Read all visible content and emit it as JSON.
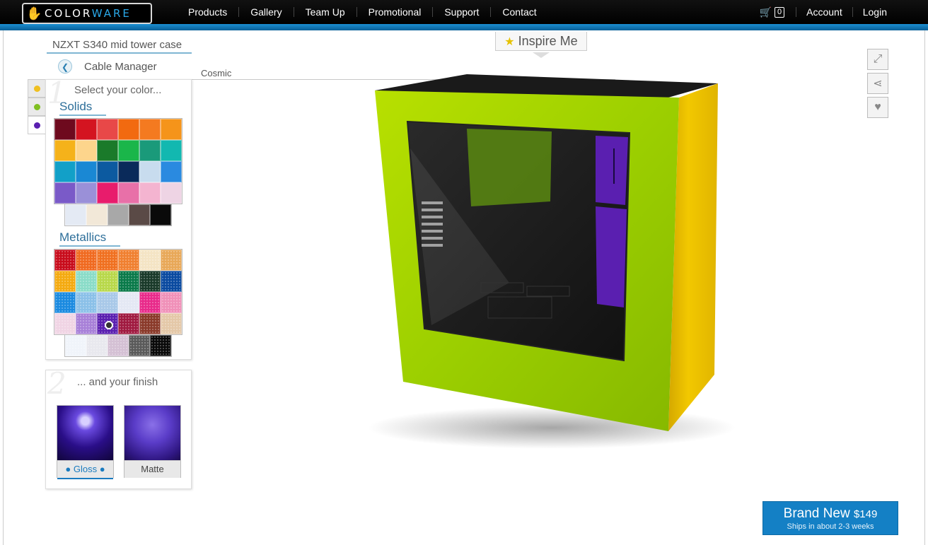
{
  "header": {
    "logo_text_a": "COLOR",
    "logo_text_b": "WARE",
    "nav": [
      "Products",
      "Gallery",
      "Team Up",
      "Promotional",
      "Support",
      "Contact"
    ],
    "cart_count": "0",
    "account": "Account",
    "login": "Login"
  },
  "product": {
    "title": "NZXT S340 mid tower case",
    "part": "Cable Manager",
    "color_name": "Cosmic"
  },
  "step1": {
    "num": "1",
    "heading": "Select your color...",
    "solids_title": "Solids",
    "metallics_title": "Metallics",
    "tab_colors": [
      "#f0c020",
      "#7fbf20",
      "#5a1fb0"
    ],
    "solids": [
      "#6e0a1e",
      "#d41420",
      "#e84848",
      "#f26a10",
      "#f47a20",
      "#f5941a",
      "#f5b21a",
      "#fdd58c",
      "#1a7a2a",
      "#1ab64a",
      "#1a9a7a",
      "#12b8b0",
      "#12a0c8",
      "#1a88d4",
      "#0c5aa0",
      "#0a2a5a",
      "#c8dcee",
      "#2a8ae0",
      "#7a5ac8",
      "#9a90d8",
      "#e81c6c",
      "#e870a8",
      "#f4b4d0",
      "#eed4e4"
    ],
    "solids_row5": [
      "#e4eaf4",
      "#f2e8d8",
      "#a8a8a8",
      "#5a4a46",
      "#0a0a0a"
    ],
    "metallics": [
      "#c80c1c",
      "#f06a20",
      "#f07020",
      "#f08030",
      "#f4e4c4",
      "#e8a858",
      "#f4aa10",
      "#8adcc8",
      "#b8d84a",
      "#0a7a4a",
      "#1a3a2a",
      "#0a4aa0",
      "#1a8ae0",
      "#8ac0e8",
      "#a8c8e8",
      "#e4e8f4",
      "#e82a8a",
      "#f090b8",
      "#f0d4e4",
      "#a880d8",
      "#5a1fb0",
      "#a01a40",
      "#8a3a2a",
      "#e4c8a8"
    ],
    "metallics_row5": [
      "#f0f4fa",
      "#e8e8ee",
      "#d4c0d4",
      "#5a5a5a",
      "#0a0a0a"
    ],
    "selected_metallic_index": 20
  },
  "step2": {
    "num": "2",
    "heading": "... and your finish",
    "gloss": "● Gloss ●",
    "matte": "Matte"
  },
  "inspire": {
    "label": "Inspire Me"
  },
  "cta": {
    "main": "Brand New",
    "price": "$149",
    "sub": "Ships in about 2-3 weeks"
  },
  "colors": {
    "case_green": "#9ccf00",
    "case_yellow": "#f2c800",
    "accent_blue": "#1480c5",
    "purple": "#5a1fb0"
  }
}
